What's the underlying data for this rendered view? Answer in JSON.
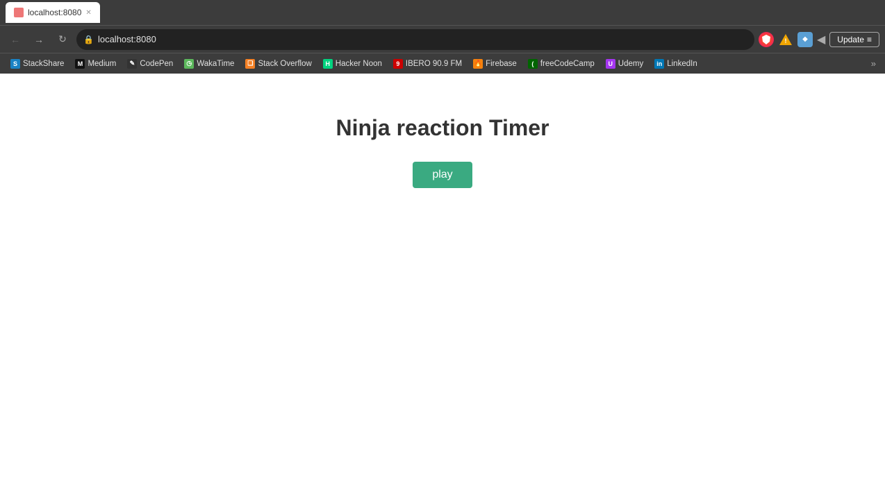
{
  "browser": {
    "tab": {
      "title": "localhost:8080",
      "favicon_color": "#e77"
    },
    "address": "localhost:8080",
    "update_label": "Update",
    "update_icon": "≡"
  },
  "bookmarks": [
    {
      "id": "stackshare",
      "label": "StackShare",
      "color": "#1a82c4",
      "icon": "S"
    },
    {
      "id": "medium",
      "label": "Medium",
      "color": "#111",
      "icon": "M"
    },
    {
      "id": "codepen",
      "label": "CodePen",
      "color": "#333",
      "icon": "✎"
    },
    {
      "id": "wakatime",
      "label": "WakaTime",
      "color": "#5cb85c",
      "icon": "◷"
    },
    {
      "id": "stackoverflow",
      "label": "Stack Overflow",
      "color": "#f48024",
      "icon": "❏"
    },
    {
      "id": "hackernoon",
      "label": "Hacker Noon",
      "color": "#00d37f",
      "icon": "H"
    },
    {
      "id": "ibero",
      "label": "IBERO 90.9 FM",
      "color": "#c00",
      "icon": "9"
    },
    {
      "id": "firebase",
      "label": "Firebase",
      "color": "#f5820d",
      "icon": "🔥"
    },
    {
      "id": "freecodecamp",
      "label": "freeCodeCamp",
      "color": "#006400",
      "icon": "(A)"
    },
    {
      "id": "udemy",
      "label": "Udemy",
      "color": "#a435f0",
      "icon": "U"
    },
    {
      "id": "linkedin",
      "label": "LinkedIn",
      "color": "#0077b5",
      "icon": "in"
    }
  ],
  "page": {
    "title": "Ninja reaction Timer",
    "play_label": "play"
  }
}
